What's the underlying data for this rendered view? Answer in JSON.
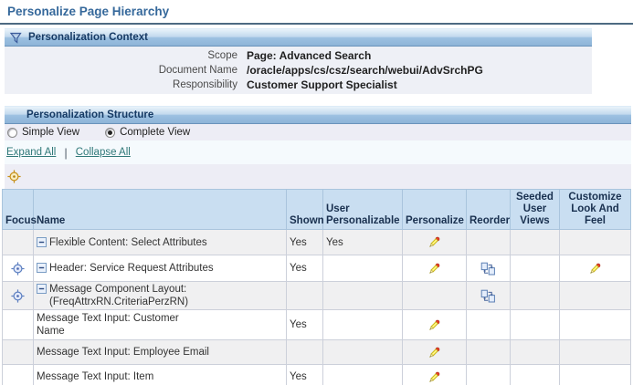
{
  "page": {
    "title": "Personalize Page Hierarchy"
  },
  "context": {
    "header": "Personalization Context",
    "fields": [
      {
        "label": "Scope",
        "value": "Page: Advanced Search"
      },
      {
        "label": "Document Name",
        "value": "/oracle/apps/cs/csz/search/webui/AdvSrchPG"
      },
      {
        "label": "Responsibility",
        "value": "Customer Support Specialist"
      }
    ]
  },
  "structure": {
    "header": "Personalization Structure",
    "view_options": [
      {
        "label": "Simple View",
        "selected": false
      },
      {
        "label": "Complete View",
        "selected": true
      }
    ],
    "links": {
      "expand_all": "Expand All",
      "collapse_all": "Collapse All",
      "separator": "|"
    },
    "table": {
      "columns": [
        "Focus",
        "Name",
        "Shown",
        "User Personalizable",
        "Personalize",
        "Reorder",
        "Seeded User Views",
        "Customize Look And Feel"
      ],
      "rows": [
        {
          "name": "Flexible Content: Select Attributes",
          "indent": 1,
          "expandable": true,
          "focus": false,
          "shown": "Yes",
          "user_personalizable": "Yes",
          "personalize": true,
          "reorder": false,
          "seeded_user_views": false,
          "customize_look_and_feel": false
        },
        {
          "name": "Header: Service Request Attributes",
          "indent": 2,
          "expandable": true,
          "focus": true,
          "shown": "Yes",
          "user_personalizable": "",
          "personalize": true,
          "reorder": true,
          "seeded_user_views": false,
          "customize_look_and_feel": true
        },
        {
          "name": "Message Component Layout: (FreqAttrxRN.CriteriaPerzRN)",
          "indent": 3,
          "expandable": true,
          "focus": true,
          "shown": "",
          "user_personalizable": "",
          "personalize": false,
          "reorder": true,
          "seeded_user_views": false,
          "customize_look_and_feel": false
        },
        {
          "name": "Message Text Input: Customer Name",
          "indent": 4,
          "expandable": false,
          "focus": false,
          "shown": "Yes",
          "user_personalizable": "",
          "personalize": true,
          "reorder": false,
          "seeded_user_views": false,
          "customize_look_and_feel": false
        },
        {
          "name": "Message Text Input: Employee Email",
          "indent": 4,
          "expandable": false,
          "focus": false,
          "shown": "",
          "user_personalizable": "",
          "personalize": true,
          "reorder": false,
          "seeded_user_views": false,
          "customize_look_and_feel": false
        },
        {
          "name": "Message Text Input: Item",
          "indent": 4,
          "expandable": false,
          "focus": false,
          "shown": "Yes",
          "user_personalizable": "",
          "personalize": true,
          "reorder": false,
          "seeded_user_views": false,
          "customize_look_and_feel": false
        }
      ]
    }
  },
  "icons": {
    "context_header": "filter-funnel-icon",
    "personalize": "pencil-icon",
    "reorder": "reorder-boxes-icon",
    "focus": "crosshair-target-icon",
    "focus_indicator": "gold-crosshair-icon",
    "expand_collapse": "minus-box-icon"
  },
  "colors": {
    "title_text": "#35689b",
    "bar_text": "#163a64",
    "bar_gradient_top": "#e9f3fa",
    "bar_gradient_bottom": "#8db4d8",
    "context_body_bg": "#eef0f6",
    "structure_body_bg": "#ededf5",
    "links_band_bg": "#f5fafd",
    "link_text": "#2f7878",
    "table_header_bg": "#c9def1",
    "banded_row_bg": "#f0f0f1",
    "pencil_yellow": "#f5e53a",
    "pencil_eraser_red": "#e8402a",
    "focus_blue": "#5c7fc0",
    "focus_gold": "#c79018"
  }
}
